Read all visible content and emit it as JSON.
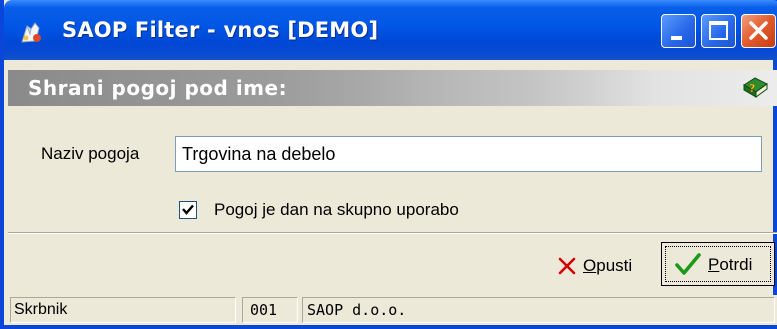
{
  "window": {
    "title": "SAOP Filter - vnos [DEMO]",
    "icon": "saop-app-icon",
    "controls": [
      "minimize-icon",
      "maximize-icon",
      "close-icon"
    ]
  },
  "header": {
    "text": "Shrani pogoj pod ime:",
    "help_icon": "help-book-icon"
  },
  "form": {
    "naziv_label": "Naziv pogoja",
    "naziv_value": "Trgovina na debelo",
    "shared_checked": true,
    "shared_label": "Pogoj je dan na skupno uporabo"
  },
  "buttons": {
    "cancel": {
      "accel": "O",
      "rest": "pusti",
      "icon": "red-x-icon",
      "icon_color": "#d40000"
    },
    "confirm": {
      "accel": "P",
      "rest": "otrdi",
      "icon": "green-check-icon",
      "icon_color": "#1a9a1a"
    }
  },
  "statusbar": {
    "user": "Skrbnik",
    "code": "001",
    "company": "SAOP d.o.o."
  },
  "colors": {
    "titlebar": "#0055e5",
    "frame": "#0a46d9",
    "background": "#ece9d8"
  }
}
